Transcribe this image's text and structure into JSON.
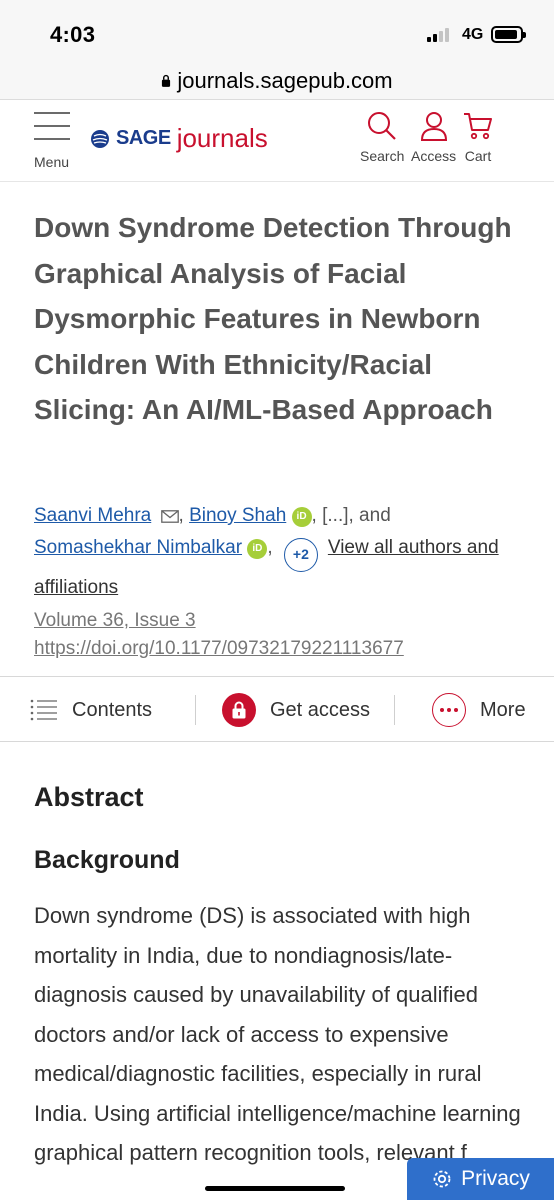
{
  "status_bar": {
    "time": "4:03",
    "network": "4G"
  },
  "browser": {
    "url": "journals.sagepub.com"
  },
  "header": {
    "menu_label": "Menu",
    "logo_sage": "SAGE",
    "logo_journals": "journals",
    "search_label": "Search",
    "access_label": "Access",
    "cart_label": "Cart"
  },
  "article": {
    "title": "Down Syndrome Detection Through Graphical Analysis of Facial Dysmorphic Features in Newborn Children With Ethnicity/Racial Slicing: An AI/ML-Based Approach",
    "authors": {
      "author1": "Saanvi Mehra",
      "author2": "Binoy Shah",
      "ellipsis": "[...], and",
      "author3": "Somashekhar Nimbalkar",
      "more_count": "+2",
      "view_all": "View all authors and affiliations"
    },
    "volume": "Volume 36, Issue 3",
    "doi": "https://doi.org/10.1177/09732179221113677"
  },
  "actions": {
    "contents": "Contents",
    "get_access": "Get access",
    "more": "More"
  },
  "abstract": {
    "heading": "Abstract",
    "subheading": "Background",
    "text": "Down syndrome (DS) is associated with high mortality in India, due to nondiagnosis/late-diagnosis caused by unavailability of qualified doctors and/or lack of access to expensive medical/diagnostic facilities, especially in rural India. Using artificial intelligence/machine learning graphical pattern recognition tools, relevant f"
  },
  "privacy": {
    "label": "Privacy"
  },
  "colors": {
    "brand_red": "#c8102e",
    "link_blue": "#1e5aa8",
    "orcid_green": "#a6ce39",
    "privacy_blue": "#2f6fcb"
  }
}
